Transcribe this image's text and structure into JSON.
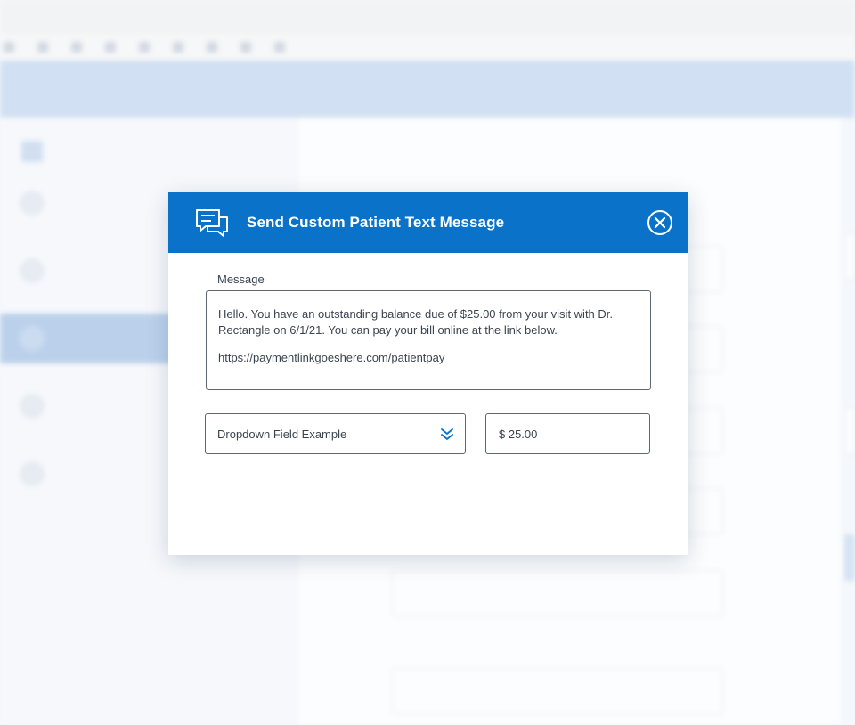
{
  "background": {
    "url_text": "",
    "bookmarks": [
      "",
      "",
      "",
      "",
      "",
      "",
      "",
      "",
      ""
    ],
    "app_title": "",
    "app_title_bold": "",
    "sidebar_items": [
      "",
      "",
      "",
      "",
      ""
    ],
    "ghost_fields": [
      "",
      ""
    ],
    "ghost_label": ""
  },
  "modal": {
    "title": "Send Custom Patient Text Message",
    "icons": {
      "header": "chat-bubbles-icon",
      "close": "close-circle-icon",
      "dropdown": "double-chevron-down-icon"
    },
    "colors": {
      "header_bg": "#0a73c9",
      "accent": "#0a73c9"
    },
    "message": {
      "label": "Message",
      "line1": "Hello. You have an outstanding balance due of $25.00 from your visit with Dr. Rectangle on 6/1/21. You can pay your bill online at the link below.",
      "line2": "https://paymentlinkgoeshere.com/patientpay"
    },
    "dropdown": {
      "value": "Dropdown Field Example"
    },
    "amount": {
      "value": "$ 25.00"
    }
  }
}
